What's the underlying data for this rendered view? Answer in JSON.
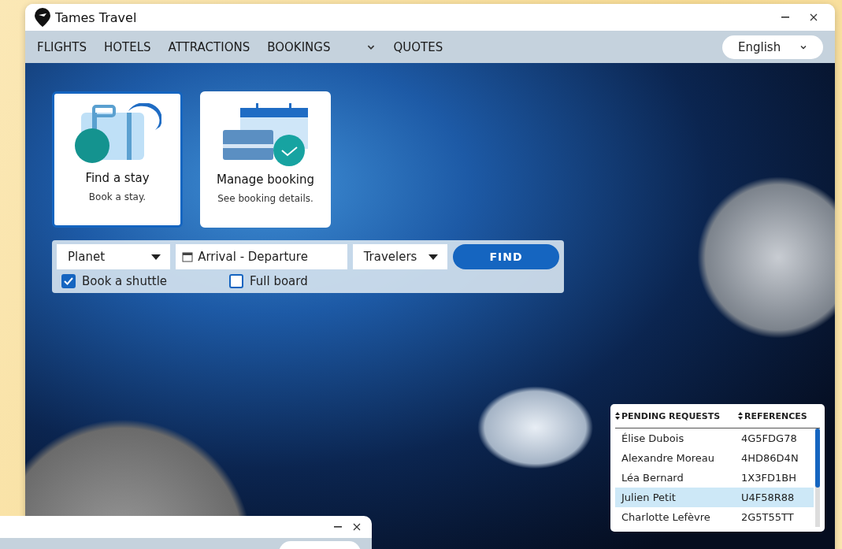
{
  "window": {
    "title": "Tames Travel"
  },
  "nav": {
    "items": [
      {
        "label": "FLIGHTS",
        "has_menu": false
      },
      {
        "label": "HOTELS",
        "has_menu": false
      },
      {
        "label": "ATTRACTIONS",
        "has_menu": false
      },
      {
        "label": "BOOKINGS",
        "has_menu": true
      },
      {
        "label": "QUOTES",
        "has_menu": false
      }
    ],
    "language": "English"
  },
  "cards": [
    {
      "kind": "stay",
      "title": "Find a stay",
      "subtitle": "Book a stay.",
      "selected": true
    },
    {
      "kind": "booking",
      "title": "Manage booking",
      "subtitle": "See booking details.",
      "selected": false
    }
  ],
  "search": {
    "planet": "Planet",
    "dates": "Arrival - Departure",
    "travelers": "Travelers",
    "button": "FIND",
    "options": [
      {
        "label": "Book a shuttle",
        "checked": true
      },
      {
        "label": "Full board",
        "checked": false
      }
    ]
  },
  "table": {
    "columns": [
      "PENDING REQUESTS",
      "REFERENCES"
    ],
    "rows": [
      {
        "name": "Élise Dubois",
        "reference": "4G5FDG78",
        "selected": false
      },
      {
        "name": "Alexandre Moreau",
        "reference": "4HD86D4N",
        "selected": false
      },
      {
        "name": "Léa Bernard",
        "reference": "1X3FD1BH",
        "selected": false
      },
      {
        "name": "Julien Petit",
        "reference": "U4F58R88",
        "selected": true
      },
      {
        "name": "Charlotte Lefèvre",
        "reference": "2G5T55TT",
        "selected": false
      }
    ]
  }
}
